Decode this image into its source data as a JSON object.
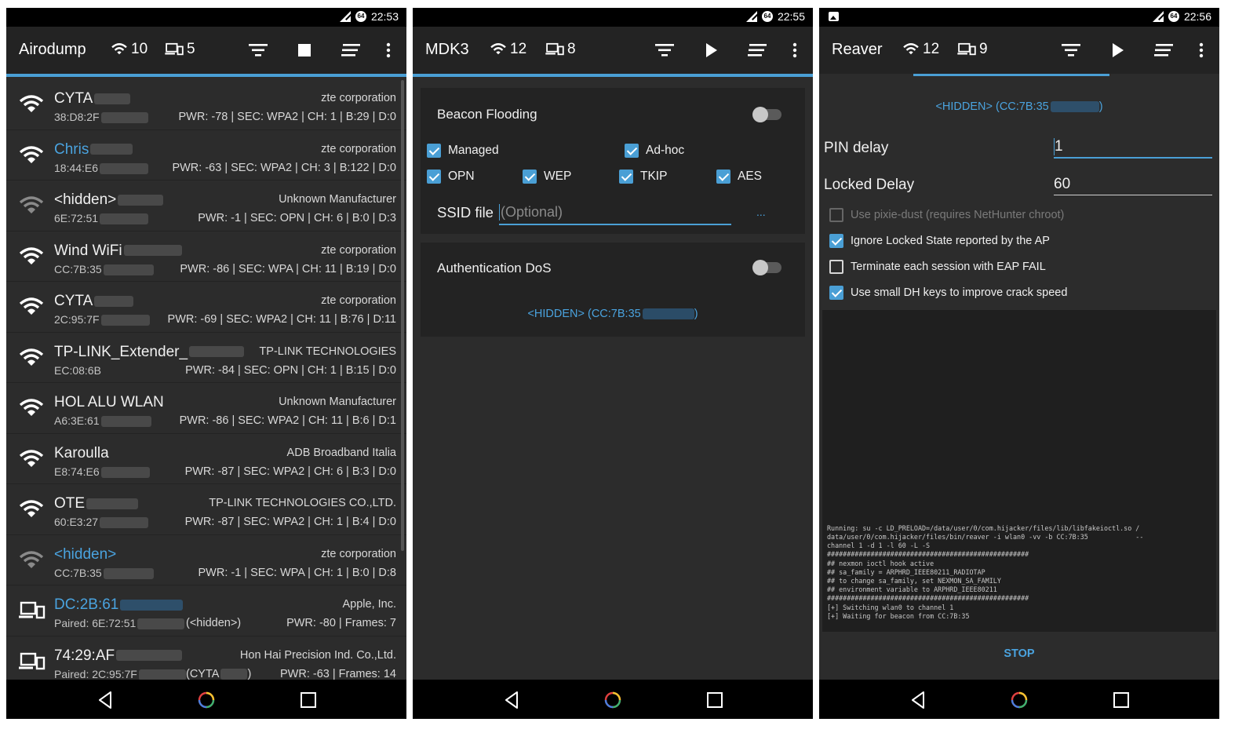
{
  "status": {
    "p1_time": "22:53",
    "p2_time": "22:55",
    "p3_time": "22:56",
    "ds_badge": "64"
  },
  "airodump": {
    "title": "Airodump",
    "ap_count": "10",
    "client_count": "5",
    "rows": [
      {
        "name": "CYTA",
        "mac": "38:D8:2F",
        "vendor": "zte corporation",
        "details": "PWR: -78 | SEC: WPA2 | CH: 1 | B:29 | D:0"
      },
      {
        "name": "Chris",
        "mac": "18:44:E6",
        "vendor": "zte corporation",
        "details": "PWR: -63 | SEC: WPA2 | CH: 3 | B:122 | D:0"
      },
      {
        "name": "<hidden>",
        "mac": "6E:72:51",
        "vendor": "Unknown Manufacturer",
        "details": "PWR: -1 | SEC: OPN | CH: 6 | B:0 | D:3"
      },
      {
        "name": "Wind WiFi",
        "mac": "CC:7B:35",
        "vendor": "zte corporation",
        "details": "PWR: -86 | SEC: WPA | CH: 11 | B:19 | D:0"
      },
      {
        "name": "CYTA",
        "mac": "2C:95:7F",
        "vendor": "zte corporation",
        "details": "PWR: -69 | SEC: WPA2 | CH: 11 | B:76 | D:11"
      },
      {
        "name": "TP-LINK_Extender_",
        "mac": "EC:08:6B",
        "vendor": "TP-LINK TECHNOLOGIES",
        "details": "PWR: -84 | SEC: OPN | CH: 1 | B:15 | D:0"
      },
      {
        "name": "HOL ALU WLAN",
        "mac": "A6:3E:61",
        "vendor": "Unknown Manufacturer",
        "details": "PWR: -86 | SEC: WPA2 | CH: 11 | B:6 | D:1"
      },
      {
        "name": "Karoulla",
        "mac": "E8:74:E6",
        "vendor": "ADB Broadband Italia",
        "details": "PWR: -87 | SEC: WPA2 | CH: 6 | B:3 | D:0"
      },
      {
        "name": "OTE",
        "mac": "60:E3:27",
        "vendor": "TP-LINK TECHNOLOGIES CO.,LTD.",
        "details": "PWR: -87 | SEC: WPA2 | CH: 1 | B:4 | D:0"
      },
      {
        "name": "<hidden>",
        "mac": "CC:7B:35",
        "vendor": "zte corporation",
        "details": "PWR: -1 | SEC: WPA | CH: 1 | B:0 | D:8"
      }
    ],
    "clients": [
      {
        "name": "DC:2B:61",
        "paired": "Paired: 6E:72:51",
        "assoc": "(<hidden>)",
        "vendor": "Apple, Inc.",
        "details": "PWR: -80 | Frames: 7"
      },
      {
        "name": "74:29:AF",
        "paired": "Paired: 2C:95:7F",
        "assoc": "(CYTA",
        "assoc_end": ")",
        "vendor": "Hon Hai Precision Ind. Co.,Ltd.",
        "details": "PWR: -63 | Frames: 14"
      }
    ]
  },
  "mdk3": {
    "title": "MDK3",
    "ap_count": "12",
    "client_count": "8",
    "beacon": {
      "header": "Beacon Flooding",
      "managed": "Managed",
      "adhoc": "Ad-hoc",
      "opn": "OPN",
      "wep": "WEP",
      "tkip": "TKIP",
      "aes": "AES",
      "ssid_label": "SSID file",
      "ssid_placeholder": "(Optional)",
      "browse": "..."
    },
    "auth": {
      "header": "Authentication DoS",
      "target": "<HIDDEN> (CC:7B:35"
    }
  },
  "reaver": {
    "title": "Reaver",
    "ap_count": "12",
    "client_count": "9",
    "target": "<HIDDEN> (CC:7B:35",
    "pin_delay_label": "PIN delay",
    "pin_delay_value": "1",
    "locked_delay_label": "Locked Delay",
    "locked_delay_value": "60",
    "opt_pixie": "Use pixie-dust (requires NetHunter chroot)",
    "opt_ignore": "Ignore Locked State reported by the AP",
    "opt_terminate": "Terminate each session with EAP FAIL",
    "opt_small_dh": "Use small DH keys to improve crack speed",
    "console": "Running: su -c LD_PRELOAD=/data/user/0/com.hijacker/files/lib/libfakeioctl.so /\ndata/user/0/com.hijacker/files/bin/reaver -i wlan0 -vv -b CC:7B:35            --\nchannel 1 -d 1 -l 60 -L -S\n###################################################\n## nexmon ioctl hook active\n## sa_family = ARPHRD_IEEE80211_RADIOTAP\n## to change sa_family, set NEXMON_SA_FAMILY\n## environment variable to ARPHRD_IEEE80211\n###################################################\n[+] Switching wlan0 to channel 1\n[+] Waiting for beacon from CC:7B:35",
    "stop": "STOP"
  },
  "colors": {
    "accent": "#4a9fd5",
    "background": "#2c2c2c",
    "card": "#232323",
    "link": "#4aa3df"
  }
}
